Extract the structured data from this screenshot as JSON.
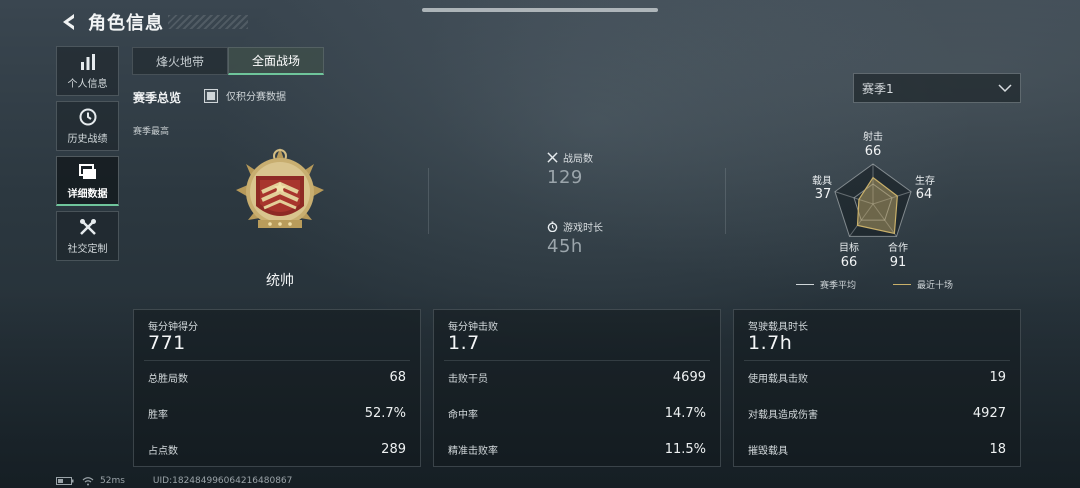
{
  "header": {
    "title": "角色信息"
  },
  "sidebar": {
    "items": [
      {
        "label": "个人信息",
        "icon": "bar-chart-icon"
      },
      {
        "label": "历史战绩",
        "icon": "history-icon"
      },
      {
        "label": "详细数据",
        "icon": "folder-icon",
        "active": true
      },
      {
        "label": "社交定制",
        "icon": "tools-icon"
      }
    ]
  },
  "tabs": [
    {
      "label": "烽火地带",
      "active": false
    },
    {
      "label": "全面战场",
      "active": true
    }
  ],
  "overview": {
    "title": "赛季总览",
    "checkbox_label": "仅积分赛数据",
    "checkbox_checked": true
  },
  "season_select": {
    "value": "赛季1"
  },
  "season_best": {
    "label": "赛季最高",
    "rank_name": "统帅"
  },
  "summary": {
    "matches_label": "战局数",
    "matches_value": "129",
    "playtime_label": "游戏时长",
    "playtime_value": "45h"
  },
  "radar": {
    "axes": [
      {
        "label": "射击",
        "value": "66"
      },
      {
        "label": "生存",
        "value": "64"
      },
      {
        "label": "合作",
        "value": "91"
      },
      {
        "label": "目标",
        "value": "66"
      },
      {
        "label": "载具",
        "value": "37"
      }
    ],
    "legend": [
      {
        "label": "赛季平均",
        "color": "#cfd5d8"
      },
      {
        "label": "最近十场",
        "color": "#c9b06a"
      }
    ]
  },
  "cards": [
    {
      "title": "每分钟得分",
      "big": "771",
      "rows": [
        {
          "label": "总胜局数",
          "value": "68"
        },
        {
          "label": "胜率",
          "value": "52.7%"
        },
        {
          "label": "占点数",
          "value": "289"
        }
      ]
    },
    {
      "title": "每分钟击败",
      "big": "1.7",
      "rows": [
        {
          "label": "击败干员",
          "value": "4699"
        },
        {
          "label": "命中率",
          "value": "14.7%"
        },
        {
          "label": "精准击败率",
          "value": "11.5%"
        }
      ]
    },
    {
      "title": "驾驶载具时长",
      "big": "1.7h",
      "rows": [
        {
          "label": "使用载具击败",
          "value": "19"
        },
        {
          "label": "对载具造成伤害",
          "value": "4927"
        },
        {
          "label": "摧毁载具",
          "value": "18"
        }
      ]
    }
  ],
  "footer": {
    "ping": "52ms",
    "uid": "UID:1824849960642164808​67"
  },
  "colors": {
    "accent": "#6fc59b",
    "gold": "#c9b06a"
  }
}
